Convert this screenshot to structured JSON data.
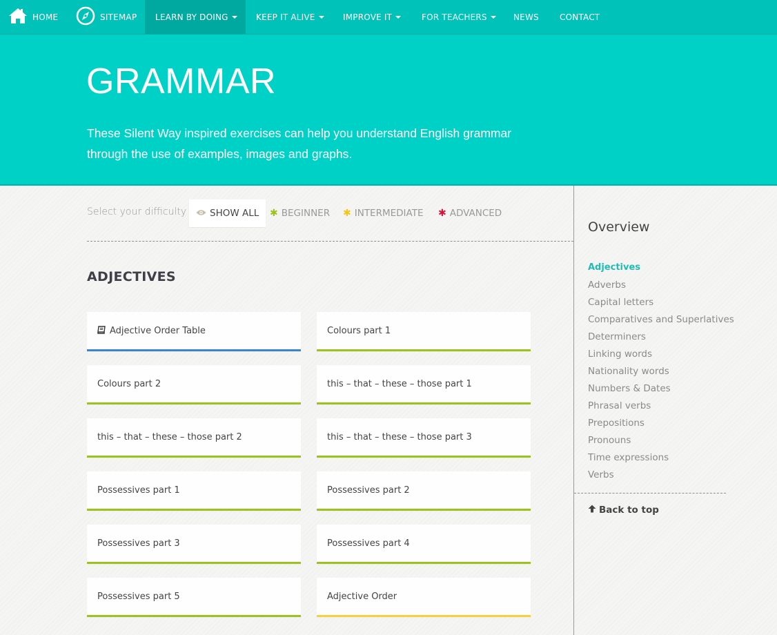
{
  "nav": {
    "home": "HOME",
    "sitemap": "SITEMAP",
    "learn": "LEARN BY DOING",
    "keep": "KEEP IT ALIVE",
    "improve": "IMPROVE IT",
    "teachers": "FOR TEACHERS",
    "news": "NEWS",
    "contact": "CONTACT"
  },
  "hero": {
    "title": "GRAMMAR",
    "description": "These Silent Way inspired exercises can help you understand English grammar through the use of examples, images and graphs."
  },
  "filter": {
    "label": "Select your difficulty :",
    "show_all": "SHOW ALL",
    "beginner": "BEGINNER",
    "intermediate": "INTERMEDIATE",
    "advanced": "ADVANCED",
    "colors": {
      "beginner": "#9cc21f",
      "intermediate": "#f5c518",
      "advanced": "#d7153a"
    }
  },
  "section": {
    "title": "ADJECTIVES",
    "cards": [
      {
        "label": "Adjective Order Table",
        "level": "table"
      },
      {
        "label": "Colours part 1",
        "level": "beginner"
      },
      {
        "label": "Colours part 2",
        "level": "beginner"
      },
      {
        "label": "this – that – these – those part 1",
        "level": "beginner"
      },
      {
        "label": "this – that – these – those part 2",
        "level": "beginner"
      },
      {
        "label": "this – that – these – those part 3",
        "level": "beginner"
      },
      {
        "label": "Possessives part 1",
        "level": "beginner"
      },
      {
        "label": "Possessives part 2",
        "level": "beginner"
      },
      {
        "label": "Possessives part 3",
        "level": "beginner"
      },
      {
        "label": "Possessives part 4",
        "level": "beginner"
      },
      {
        "label": "Possessives part 5",
        "level": "beginner"
      },
      {
        "label": "Adjective Order",
        "level": "intermediate"
      }
    ]
  },
  "sidebar": {
    "title": "Overview",
    "links": [
      "Adjectives",
      "Adverbs",
      "Capital letters",
      "Comparatives and Superlatives",
      "Determiners",
      "Linking words",
      "Nationality words",
      "Numbers & Dates",
      "Phrasal verbs",
      "Prepositions",
      "Pronouns",
      "Time expressions",
      "Verbs"
    ],
    "back_to_top": "Back to top"
  }
}
